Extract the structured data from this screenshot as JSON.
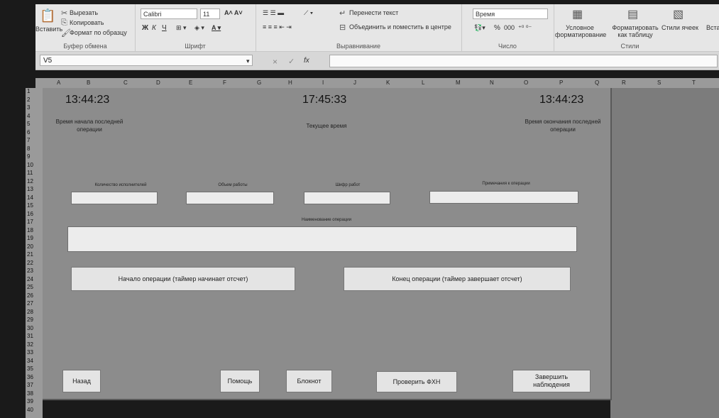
{
  "ribbon": {
    "clipboard": {
      "paste": "Вставить",
      "cut": "Вырезать",
      "copy": "Копировать",
      "format_painter": "Формат по образцу",
      "title": "Буфер обмена"
    },
    "font": {
      "name": "Calibri",
      "size": "11",
      "bold": "Ж",
      "italic": "К",
      "underline": "Ч",
      "title": "Шрифт"
    },
    "alignment": {
      "wrap": "Перенести текст",
      "merge": "Объединить и поместить в центре",
      "title": "Выравнивание"
    },
    "number": {
      "format": "Время",
      "percent": "%",
      "thousands": "000",
      "title": "Число"
    },
    "styles": {
      "conditional": "Условное форматирование",
      "as_table": "Форматировать как таблицу",
      "cell_styles": "Стили ячеек",
      "title": "Стили"
    },
    "insert": "Вста"
  },
  "formula_bar": {
    "cell_ref": "V5",
    "fx": "fx",
    "cancel": "×",
    "enter": "✓"
  },
  "columns": [
    "A",
    "B",
    "C",
    "D",
    "E",
    "F",
    "G",
    "H",
    "I",
    "J",
    "K",
    "L",
    "M",
    "N",
    "O",
    "P",
    "Q",
    "R",
    "S",
    "T"
  ],
  "rows": [
    "1",
    "2",
    "3",
    "4",
    "5",
    "6",
    "7",
    "8",
    "9",
    "10",
    "11",
    "12",
    "13",
    "14",
    "15",
    "16",
    "17",
    "18",
    "19",
    "20",
    "21",
    "22",
    "23",
    "24",
    "25",
    "26",
    "27",
    "28",
    "29",
    "30",
    "31",
    "32",
    "33",
    "34",
    "35",
    "36",
    "37",
    "38",
    "39",
    "40"
  ],
  "form": {
    "start_time": "13:44:23",
    "current_time": "17:45:33",
    "end_time": "13:44:23",
    "start_label": "Время начала последней операции",
    "current_label": "Текущее время",
    "end_label": "Время окончания последней операции",
    "workers_label": "Количество исполнителей",
    "volume_label": "Объем работы",
    "code_label": "Шифр работ",
    "note_label": "Примечания к операции",
    "operation_label": "Наименование операции",
    "start_button": "Начало операции (таймер начинает отсчет)",
    "end_button": "Конец операции (таймер завершает отсчет)",
    "back_button": "Назад",
    "help_button": "Помощь",
    "notepad_button": "Блокнот",
    "check_button": "Проверить ФХН",
    "finish_button": "Завершить наблюдения"
  }
}
